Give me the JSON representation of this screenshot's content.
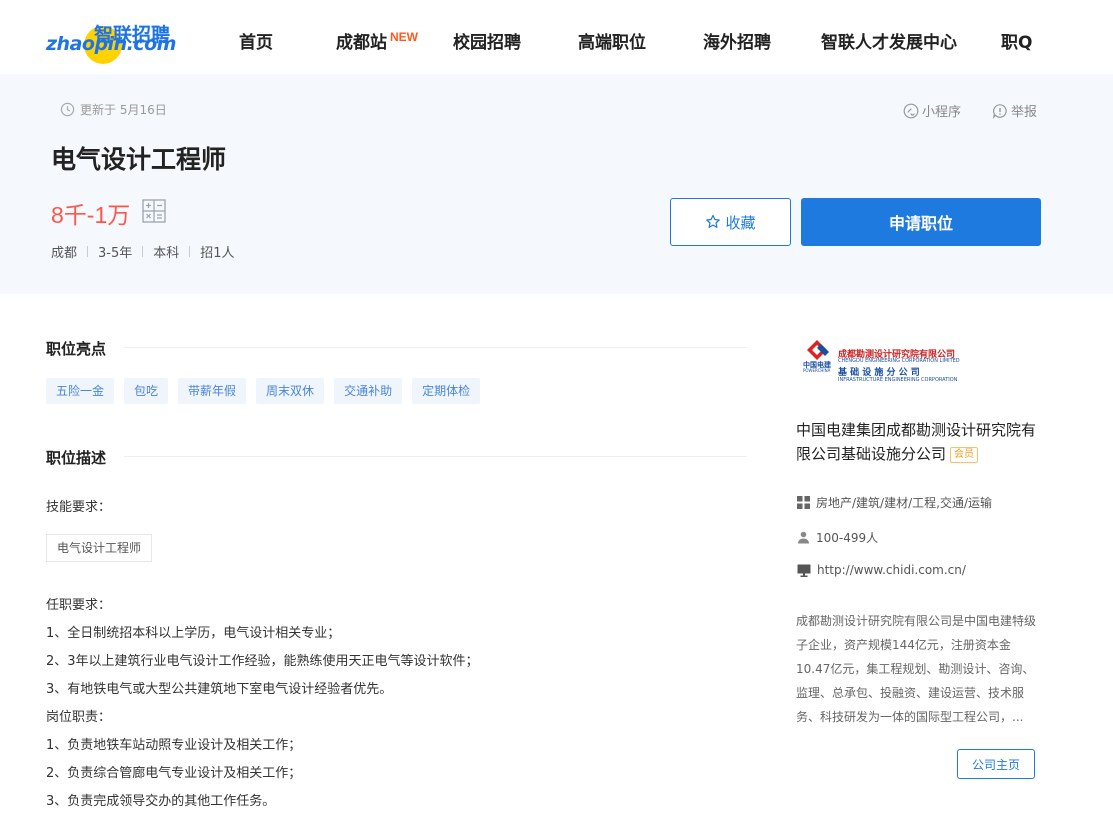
{
  "brand": {
    "logo_cn": "智联招聘",
    "logo_en": "zhaopin.com"
  },
  "nav": {
    "items": [
      {
        "label": "首页"
      },
      {
        "label": "成都站",
        "badge": "NEW"
      },
      {
        "label": "校园招聘"
      },
      {
        "label": "高端职位"
      },
      {
        "label": "海外招聘"
      },
      {
        "label": "智联人才发展中心"
      },
      {
        "label": "职Q"
      }
    ]
  },
  "job": {
    "updated": "更新于 5月16日",
    "mini_program": "小程序",
    "report": "举报",
    "title": "电气设计工程师",
    "salary": "8千-1万",
    "meta": [
      "成都",
      "3-5年",
      "本科",
      "招1人"
    ],
    "favorite_label": "收藏",
    "apply_label": "申请职位"
  },
  "highlights": {
    "title": "职位亮点",
    "tags": [
      "五险一金",
      "包吃",
      "带薪年假",
      "周末双休",
      "交通补助",
      "定期体检"
    ]
  },
  "description": {
    "title": "职位描述",
    "skills_label": "技能要求：",
    "skill_tag": "电气设计工程师",
    "lines": [
      "任职要求：",
      "1、全日制统招本科以上学历，电气设计相关专业；",
      "2、3年以上建筑行业电气设计工作经验，能熟练使用天正电气等设计软件；",
      "3、有地铁电气或大型公共建筑地下室电气设计经验者优先。",
      "岗位职责：",
      "1、负责地铁车站动照专业设计及相关工作；",
      "2、负责综合管廊电气专业设计及相关工作；",
      "3、负责完成领导交办的其他工作任务。"
    ]
  },
  "company": {
    "logo_line1": "成都勘测设计研究院有限公司",
    "logo_line2": "CHENGDU ENGINEERING CORPORATION LIMITED",
    "logo_line3": "基 础 设 施 分 公 司",
    "logo_line4": "INFRASTRUCTURE ENGINEERING CORPORATION",
    "logo_mark": "中国电建",
    "logo_mark_en": "POWERCHINA",
    "name": "中国电建集团成都勘测设计研究院有限公司基础设施分公司",
    "vip": "会员",
    "industry": "房地产/建筑/建材/工程,交通/运输",
    "size": "100-499人",
    "website": "http://www.chidi.com.cn/",
    "desc": "成都勘测设计研究院有限公司是中国电建特级子企业，资产规模144亿元，注册资本金10.47亿元，集工程规划、勘测设计、咨询、监理、总承包、投融资、建设运营、技术服务、科技研发为一体的国际型工程公司，...",
    "home_button": "公司主页"
  }
}
